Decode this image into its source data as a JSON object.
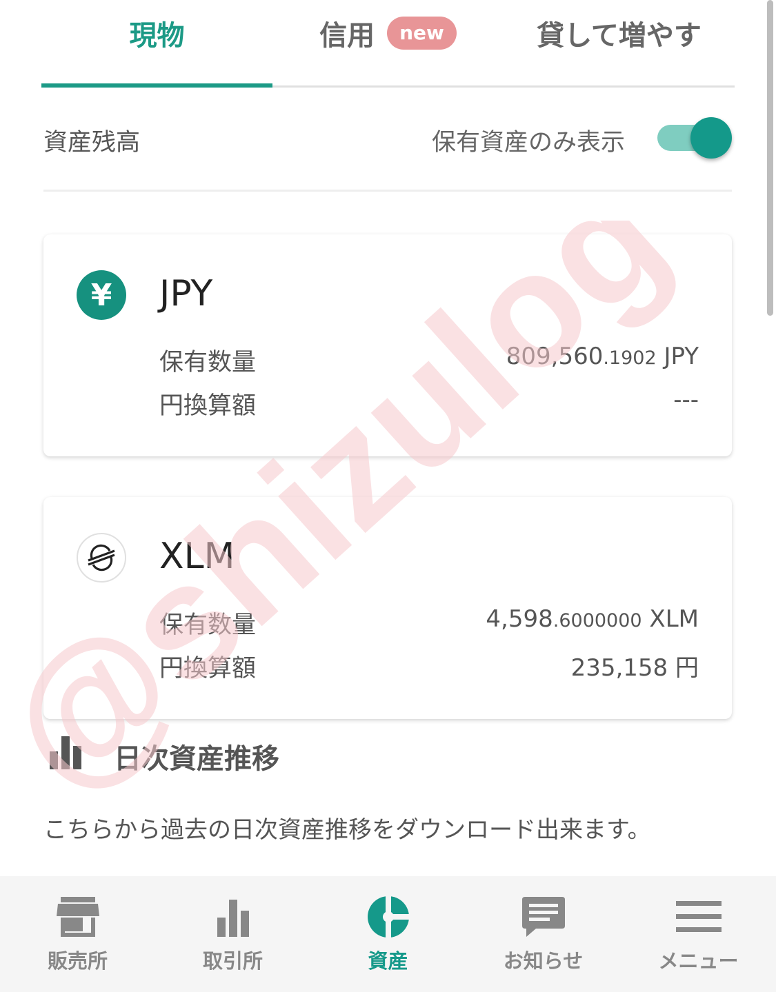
{
  "tabs": [
    {
      "label": "現物",
      "active": true
    },
    {
      "label": "信用",
      "badge": "new"
    },
    {
      "label": "貸して増やす"
    }
  ],
  "balance": {
    "title": "資産残高",
    "filter_label": "保有資産のみ表示",
    "filter_on": true
  },
  "assets": [
    {
      "name": "JPY",
      "icon": "yen-icon",
      "icon_glyph": "¥",
      "qty_label": "保有数量",
      "qty_int": "809,560",
      "qty_dec": ".1902",
      "qty_unit": " JPY",
      "yen_label": "円換算額",
      "yen_value": "---"
    },
    {
      "name": "XLM",
      "icon": "stellar-icon",
      "qty_label": "保有数量",
      "qty_int": "4,598",
      "qty_dec": ".6000000",
      "qty_unit": " XLM",
      "yen_label": "円換算額",
      "yen_value": "235,158 円"
    }
  ],
  "daily": {
    "title": "日次資産推移",
    "description": "こちらから過去の日次資産推移をダウンロード出来ます。"
  },
  "nav": [
    {
      "label": "販売所",
      "icon": "store-icon"
    },
    {
      "label": "取引所",
      "icon": "bar-chart-icon"
    },
    {
      "label": "資産",
      "icon": "pie-chart-icon",
      "active": true
    },
    {
      "label": "お知らせ",
      "icon": "message-icon"
    },
    {
      "label": "メニュー",
      "icon": "menu-icon"
    }
  ],
  "watermark": "@shizulog",
  "colors": {
    "accent": "#1c9a86",
    "badge": "#e89597",
    "watermark": "#f6c9cc"
  }
}
